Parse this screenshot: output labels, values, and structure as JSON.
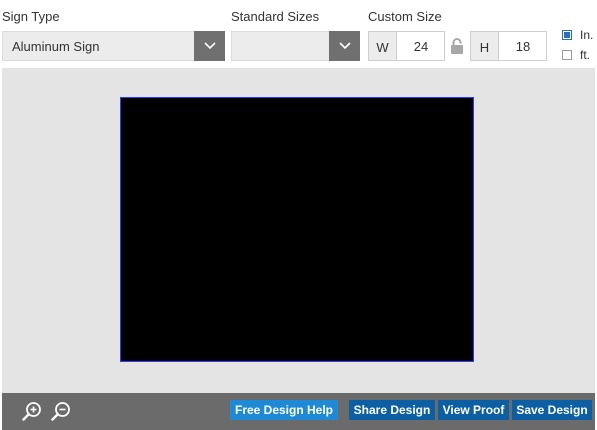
{
  "sign_type": {
    "label": "Sign Type",
    "selected": "Aluminum Sign"
  },
  "standard_sizes": {
    "label": "Standard Sizes",
    "selected": ""
  },
  "custom_size": {
    "label": "Custom Size",
    "width_prefix": "W",
    "width_value": "24",
    "height_prefix": "H",
    "height_value": "18"
  },
  "units": {
    "inches_label": "In.",
    "inches_checked": true,
    "feet_label": "ft.",
    "feet_checked": false
  },
  "preview": {
    "fill_color": "#000000",
    "border_color": "#2a3cff"
  },
  "toolbar": {
    "free_design_help": "Free Design Help",
    "share_design": "Share Design",
    "view_proof": "View Proof",
    "save_design": "Save Design"
  },
  "colors": {
    "accent_light": "#1e8ad6",
    "accent_dark": "#0c5fa3",
    "toolbar_bg": "#6b6b6b"
  }
}
